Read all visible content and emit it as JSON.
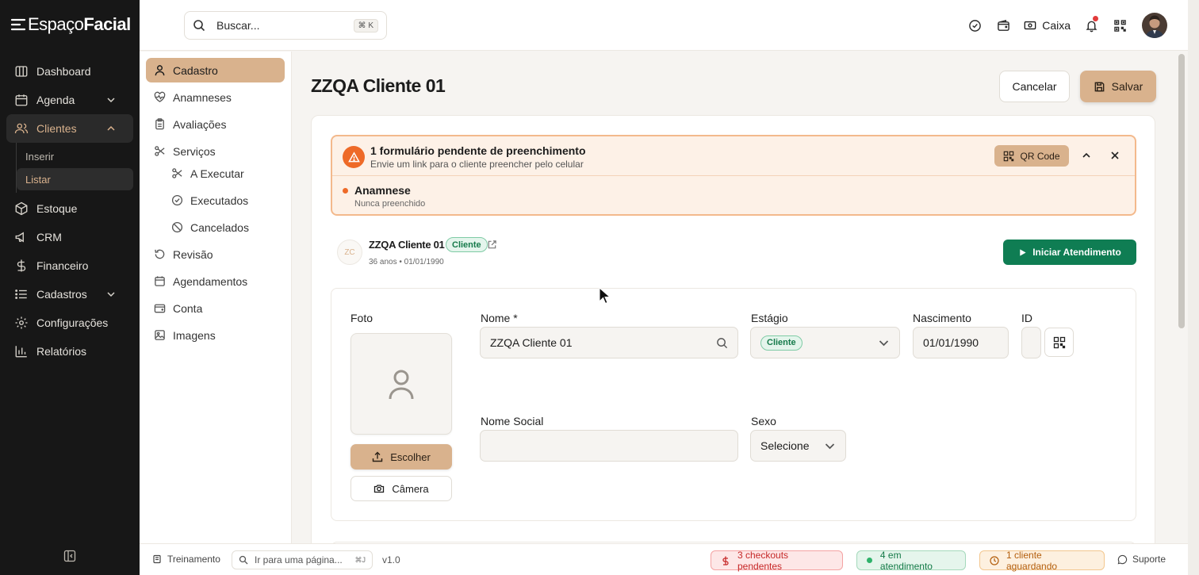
{
  "brand": {
    "name_light": "Espaço",
    "name_bold": "Facial"
  },
  "sidebar": {
    "items": [
      {
        "label": "Dashboard",
        "icon": "dashboard-icon"
      },
      {
        "label": "Agenda",
        "icon": "calendar-icon",
        "chevron": "down"
      },
      {
        "label": "Clientes",
        "icon": "users-icon",
        "chevron": "up",
        "active": true
      },
      {
        "label": "Estoque",
        "icon": "box-icon"
      },
      {
        "label": "CRM",
        "icon": "megaphone-icon"
      },
      {
        "label": "Financeiro",
        "icon": "dollar-icon"
      },
      {
        "label": "Cadastros",
        "icon": "list-icon",
        "chevron": "down"
      },
      {
        "label": "Configurações",
        "icon": "gear-icon"
      },
      {
        "label": "Relatórios",
        "icon": "bar-chart-icon"
      }
    ],
    "clientes_sub": [
      "Inserir",
      "Listar"
    ],
    "active_sub": "Listar"
  },
  "topbar": {
    "search_placeholder": "Buscar...",
    "search_shortcut": "⌘ K",
    "caixa_label": "Caixa"
  },
  "subnav": {
    "items": [
      {
        "label": "Cadastro",
        "icon": "user-icon",
        "active": true
      },
      {
        "label": "Anamneses",
        "icon": "heart-pulse-icon"
      },
      {
        "label": "Avaliações",
        "icon": "clipboard-icon"
      },
      {
        "label": "Serviços",
        "icon": "scissors-icon"
      },
      {
        "label": "A Executar",
        "icon": "scissors-icon",
        "child": true
      },
      {
        "label": "Executados",
        "icon": "check-circle-icon",
        "child": true
      },
      {
        "label": "Cancelados",
        "icon": "ban-icon",
        "child": true
      },
      {
        "label": "Revisão",
        "icon": "rotate-icon"
      },
      {
        "label": "Agendamentos",
        "icon": "calendar-icon"
      },
      {
        "label": "Conta",
        "icon": "wallet-icon"
      },
      {
        "label": "Imagens",
        "icon": "image-icon"
      }
    ]
  },
  "page": {
    "title": "ZZQA Cliente 01",
    "cancel_label": "Cancelar",
    "save_label": "Salvar"
  },
  "alert": {
    "title": "1 formulário pendente de preenchimento",
    "subtitle": "Envie um link para o cliente preencher pelo celular",
    "qr_label": "QR Code",
    "item_title": "Anamnese",
    "item_sub": "Nunca preenchido"
  },
  "client": {
    "initials": "ZC",
    "name": "ZZQA Cliente 01",
    "badge": "Cliente",
    "meta": "36 anos • 01/01/1990",
    "start_label": "Iniciar Atendimento"
  },
  "form": {
    "photo_label": "Foto",
    "choose_label": "Escolher",
    "camera_label": "Câmera",
    "name_label": "Nome *",
    "name_value": "ZZQA Cliente 01",
    "stage_label": "Estágio",
    "stage_value": "Cliente",
    "birth_label": "Nascimento",
    "birth_value": "01/01/1990",
    "id_label": "ID",
    "id_value": "",
    "social_label": "Nome Social",
    "social_value": "",
    "sex_label": "Sexo",
    "sex_value": "Selecione"
  },
  "statusbar": {
    "env": "Treinamento",
    "nav_placeholder": "Ir para uma página...",
    "nav_shortcut": "⌘J",
    "version": "v1.0",
    "checkouts": "3 checkouts pendentes",
    "attending": "4 em atendimento",
    "waiting": "1 cliente aguardando",
    "support": "Suporte"
  },
  "colors": {
    "accent": "#d9b28d",
    "sidebar_bg": "#171717",
    "success": "#0f7d53",
    "alert_orange": "#ee6a28"
  }
}
